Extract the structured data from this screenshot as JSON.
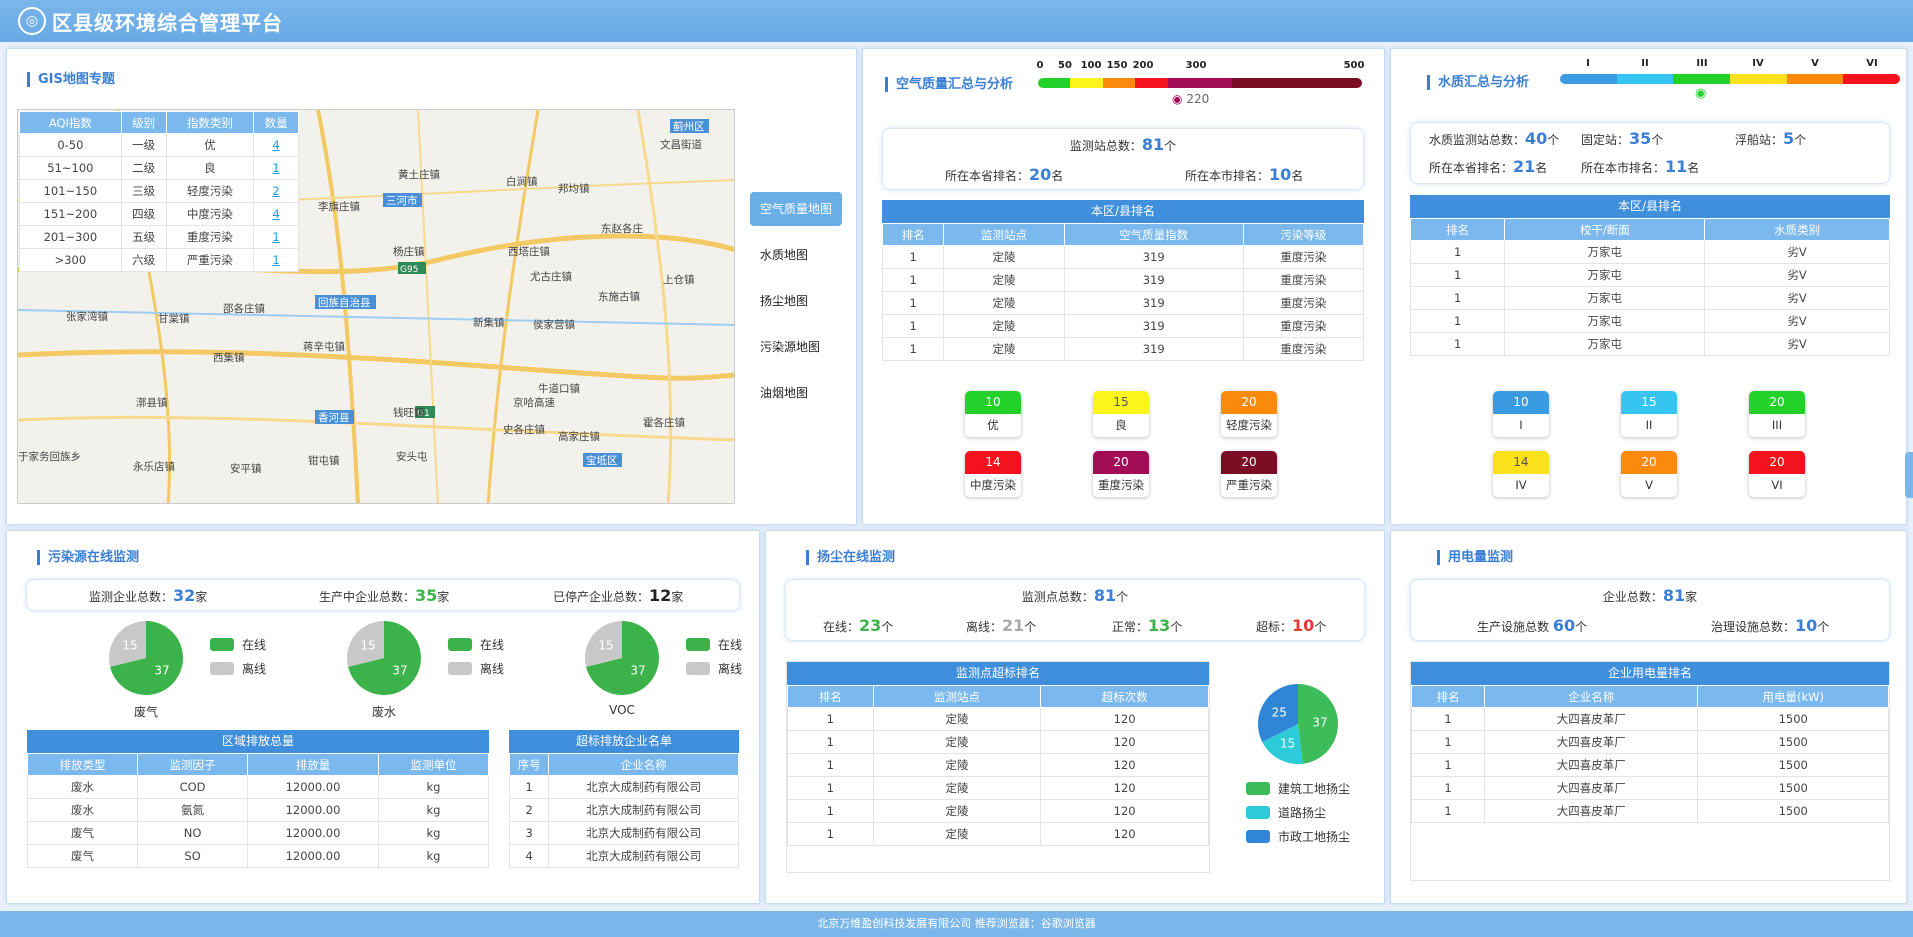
{
  "app": {
    "title": "区县级环境综合管理平台",
    "footer": "北京万维盈创科技发展有限公司 推荐浏览器：谷歌浏览器"
  },
  "gis": {
    "title": "GIS地图专题",
    "legend_headers": [
      "AQI指数",
      "级别",
      "指数类别",
      "数量"
    ],
    "legend_rows": [
      [
        "0-50",
        "一级",
        "优",
        "4"
      ],
      [
        "51~100",
        "二级",
        "良",
        "1"
      ],
      [
        "101~150",
        "三级",
        "轻度污染",
        "2"
      ],
      [
        "151~200",
        "四级",
        "中度污染",
        "4"
      ],
      [
        "201~300",
        "五级",
        "重度污染",
        "1"
      ],
      [
        ">300",
        "六级",
        "严重污染",
        "1"
      ]
    ],
    "map_labels": [
      "蓟州区",
      "文昌街道",
      "黄土庄镇",
      "白涧镇",
      "邦均镇",
      "李旗庄镇",
      "三河市",
      "东赵各庄",
      "杨庄镇",
      "西塔庄镇",
      "G95",
      "尤古庄镇",
      "上仓镇",
      "东施古镇",
      "回族自治县",
      "张家湾镇",
      "甘棠镇",
      "邵各庄镇",
      "新集镇",
      "侯家营镇",
      "西集镇",
      "蒋辛屯镇",
      "牛道口镇",
      "漷县镇",
      "G1",
      "香河县",
      "钱旺镇",
      "京哈高速",
      "霍各庄镇",
      "史各庄镇",
      "高家庄镇",
      "于家务回族乡",
      "永乐店镇",
      "安平镇",
      "钳屯镇",
      "安头屯",
      "宝坻区"
    ],
    "nav": [
      "空气质量地图",
      "水质地图",
      "扬尘地图",
      "污染源地图",
      "油烟地图"
    ]
  },
  "air": {
    "title": "空气质量汇总与分析",
    "scale_ticks": [
      "0",
      "50",
      "100",
      "150",
      "200",
      "300",
      "500"
    ],
    "current_aqi": "220",
    "station_total_label": "监测站总数：",
    "station_total": "81",
    "unit_ge": "个",
    "prov_rank_label": "所在本省排名：",
    "prov_rank": "20",
    "city_rank_label": "所在本市排名：",
    "city_rank": "10",
    "unit_ming": "名",
    "table_caption": "本区/县排名",
    "headers": [
      "排名",
      "监测站点",
      "空气质量指数",
      "污染等级"
    ],
    "rows": [
      [
        "1",
        "定陵",
        "319",
        "重度污染"
      ],
      [
        "1",
        "定陵",
        "319",
        "重度污染"
      ],
      [
        "1",
        "定陵",
        "319",
        "重度污染"
      ],
      [
        "1",
        "定陵",
        "319",
        "重度污染"
      ],
      [
        "1",
        "定陵",
        "319",
        "重度污染"
      ]
    ],
    "badges": [
      {
        "n": "10",
        "l": "优",
        "c": "#22d22a"
      },
      {
        "n": "15",
        "l": "良",
        "c": "#fbf51c"
      },
      {
        "n": "20",
        "l": "轻度污染",
        "c": "#fa8a0c"
      },
      {
        "n": "14",
        "l": "中度污染",
        "c": "#f4121e"
      },
      {
        "n": "20",
        "l": "重度污染",
        "c": "#a20c55"
      },
      {
        "n": "20",
        "l": "严重污染",
        "c": "#7b0d24"
      }
    ]
  },
  "water": {
    "title": "水质汇总与分析",
    "scale_ticks": [
      "I",
      "II",
      "III",
      "IV",
      "V",
      "VI"
    ],
    "station_total_label": "水质监测站总数：",
    "station_total": "40",
    "fixed_label": "固定站：",
    "fixed": "35",
    "float_label": "浮船站：",
    "float": "5",
    "unit_ge": "个",
    "prov_rank_label": "所在本省排名：",
    "prov_rank": "21",
    "city_rank_label": "所在本市排名：",
    "city_rank": "11",
    "unit_ming": "名",
    "table_caption": "本区/县排名",
    "headers": [
      "排名",
      "校干/断面",
      "水质类别"
    ],
    "rows": [
      [
        "1",
        "万家屯",
        "劣V"
      ],
      [
        "1",
        "万家屯",
        "劣V"
      ],
      [
        "1",
        "万家屯",
        "劣V"
      ],
      [
        "1",
        "万家屯",
        "劣V"
      ],
      [
        "1",
        "万家屯",
        "劣V"
      ]
    ],
    "badges": [
      {
        "n": "10",
        "l": "I",
        "c": "#3a9be0"
      },
      {
        "n": "15",
        "l": "II",
        "c": "#35c5f0"
      },
      {
        "n": "20",
        "l": "III",
        "c": "#22d22a"
      },
      {
        "n": "14",
        "l": "IV",
        "c": "#fbe01c"
      },
      {
        "n": "20",
        "l": "V",
        "c": "#fa8a0c"
      },
      {
        "n": "20",
        "l": "VI",
        "c": "#f4121e"
      }
    ]
  },
  "pollution": {
    "title": "污染源在线监测",
    "monitored_label": "监测企业总数：",
    "monitored": "32",
    "producing_label": "生产中企业总数：",
    "producing": "35",
    "stopped_label": "已停产企业总数：",
    "stopped": "12",
    "unit": "家",
    "pies": [
      {
        "name": "废气",
        "online": 37,
        "offline": 15
      },
      {
        "name": "废水",
        "online": 37,
        "offline": 15
      },
      {
        "name": "VOC",
        "online": 37,
        "offline": 15
      }
    ],
    "legend_online": "在线",
    "legend_offline": "离线",
    "emission_caption": "区域排放总量",
    "emission_headers": [
      "排放类型",
      "监测因子",
      "排放量",
      "监测单位"
    ],
    "emission_rows": [
      [
        "废水",
        "COD",
        "12000.00",
        "kg"
      ],
      [
        "废水",
        "氨氮",
        "12000.00",
        "kg"
      ],
      [
        "废气",
        "NO",
        "12000.00",
        "kg"
      ],
      [
        "废气",
        "SO",
        "12000.00",
        "kg"
      ]
    ],
    "exceed_caption": "超标排放企业名单",
    "exceed_headers": [
      "序号",
      "企业名称"
    ],
    "exceed_rows": [
      [
        "1",
        "北京大成制药有限公司"
      ],
      [
        "2",
        "北京大成制药有限公司"
      ],
      [
        "3",
        "北京大成制药有限公司"
      ],
      [
        "4",
        "北京大成制药有限公司"
      ]
    ]
  },
  "dust": {
    "title": "扬尘在线监测",
    "points_label": "监测点总数：",
    "points": "81",
    "unit_ge": "个",
    "online_label": "在线：",
    "online": "23",
    "offline_label": "离线：",
    "offline": "21",
    "normal_label": "正常：",
    "normal": "13",
    "exceed_label": "超标：",
    "exceed": "10",
    "table_caption": "监测点超标排名",
    "headers": [
      "排名",
      "监测站点",
      "超标次数"
    ],
    "rows": [
      [
        "1",
        "定陵",
        "120"
      ],
      [
        "1",
        "定陵",
        "120"
      ],
      [
        "1",
        "定陵",
        "120"
      ],
      [
        "1",
        "定陵",
        "120"
      ],
      [
        "1",
        "定陵",
        "120"
      ],
      [
        "1",
        "定陵",
        "120"
      ]
    ],
    "pie": [
      {
        "name": "建筑工地扬尘",
        "value": 37,
        "color": "#3dbd5a"
      },
      {
        "name": "道路扬尘",
        "value": 15,
        "color": "#2dcbd8"
      },
      {
        "name": "市政工地扬尘",
        "value": 25,
        "color": "#2f86d6"
      }
    ]
  },
  "power": {
    "title": "用电量监测",
    "ent_label": "企业总数：",
    "ent": "81",
    "unit_jia": "家",
    "prod_label": "生产设施总数",
    "prod": "60",
    "treat_label": "治理设施总数：",
    "treat": "10",
    "unit_ge": "个",
    "table_caption": "企业用电量排名",
    "headers": [
      "排名",
      "企业名称",
      "用电量(kW)"
    ],
    "rows": [
      [
        "1",
        "大四喜皮革厂",
        "1500"
      ],
      [
        "1",
        "大四喜皮革厂",
        "1500"
      ],
      [
        "1",
        "大四喜皮革厂",
        "1500"
      ],
      [
        "1",
        "大四喜皮革厂",
        "1500"
      ],
      [
        "1",
        "大四喜皮革厂",
        "1500"
      ]
    ]
  },
  "colors": {
    "accent": "#3a7fd5",
    "online": "#3cb34a",
    "offline": "#c8c8c8"
  }
}
